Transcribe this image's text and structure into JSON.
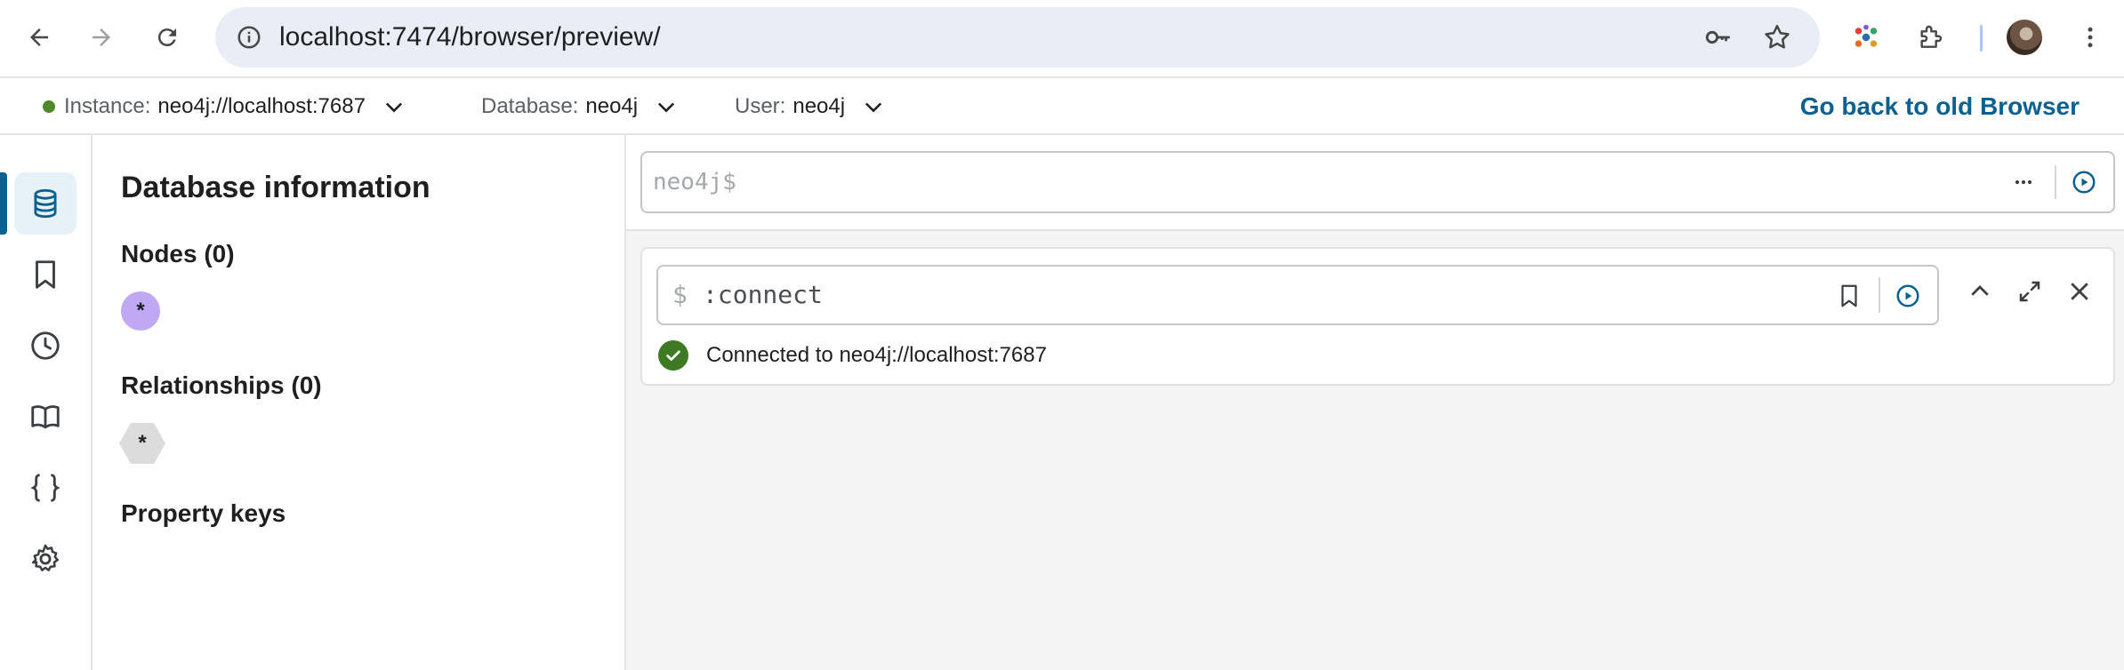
{
  "browser": {
    "url": "localhost:7474/browser/preview/"
  },
  "connection_bar": {
    "instance_label": "Instance:",
    "instance_value": "neo4j://localhost:7687",
    "database_label": "Database:",
    "database_value": "neo4j",
    "user_label": "User:",
    "user_value": "neo4j",
    "old_browser_link": "Go back to old Browser",
    "status_color": "#4d8a2a"
  },
  "left_nav": {
    "items": [
      {
        "icon": "database-icon",
        "active": true
      },
      {
        "icon": "bookmark-icon",
        "active": false
      },
      {
        "icon": "history-clock-icon",
        "active": false
      },
      {
        "icon": "book-icon",
        "active": false
      },
      {
        "icon": "curly-braces-icon",
        "active": false
      },
      {
        "icon": "gear-icon",
        "active": false
      }
    ]
  },
  "db_info": {
    "title": "Database information",
    "nodes_heading": "Nodes (0)",
    "node_chip": "*",
    "relationships_heading": "Relationships (0)",
    "relationship_chip": "*",
    "property_keys_heading": "Property keys"
  },
  "editor": {
    "prompt": "neo4j$"
  },
  "frame": {
    "prompt_symbol": "$",
    "command": ":connect",
    "result_message": "Connected to neo4j://localhost:7687",
    "success_color": "#3e7a24"
  },
  "colors": {
    "accent": "#0a6190",
    "node_chip": "#c1a8f5",
    "relationship_chip": "#dcdcdc"
  }
}
